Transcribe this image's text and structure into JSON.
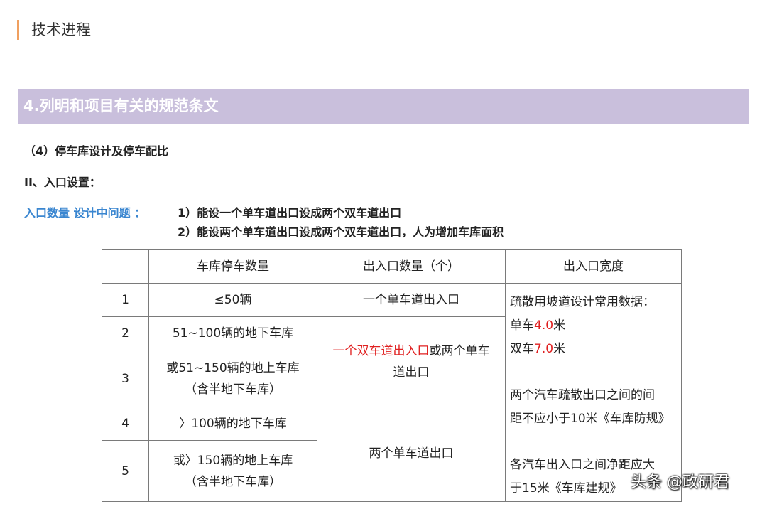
{
  "header": {
    "title": "技术进程"
  },
  "banner": {
    "text": "4.列明和项目有关的规范条文"
  },
  "section": {
    "subtitle": "（4）停车库设计及停车配比",
    "heading": "II、入口设置：",
    "label": "入口数量  设计中问题 ：",
    "issues": [
      "1）能设一个单车道出口设成两个双车道出口",
      "2）能设两个单车道出口设成两个双车道出口，人为增加车库面积"
    ]
  },
  "table": {
    "headers": [
      "",
      "车库停车数量",
      "出入口数量（个）",
      "出入口宽度"
    ],
    "rows": [
      {
        "no": "1",
        "count": "≤50辆"
      },
      {
        "no": "2",
        "count": "51~100辆的地下车库"
      },
      {
        "no": "3",
        "count_l1": "或51~150辆的地上车库",
        "count_l2": "（含半地下车库）"
      },
      {
        "no": "4",
        "count": "〉100辆的地下车库"
      },
      {
        "no": "5",
        "count_l1": "或〉150辆的地上车库",
        "count_l2": "（含半地下车库）"
      }
    ],
    "exits": {
      "one": "一个单车道出入口",
      "double_red": "一个双车道出入口",
      "double_rest_l1": "或两个单车",
      "double_rest_l2": "道出口",
      "two": "两个单车道出口"
    },
    "width": {
      "intro": "疏散用坡道设计常用数据：",
      "single_label": "单车",
      "single_value": "4.0",
      "double_label": "双车",
      "double_value": "7.0",
      "unit": "米",
      "rule1_l1": "两个汽车疏散出口之间的间",
      "rule1_l2": "距不应小于10米《车库防规》",
      "rule2_l1": "各汽车出入口之间净距应大",
      "rule2_l2": "于15米《车库建规》"
    },
    "highlight_color": "#e02020"
  },
  "watermark": {
    "text": "头条 @政研君"
  }
}
